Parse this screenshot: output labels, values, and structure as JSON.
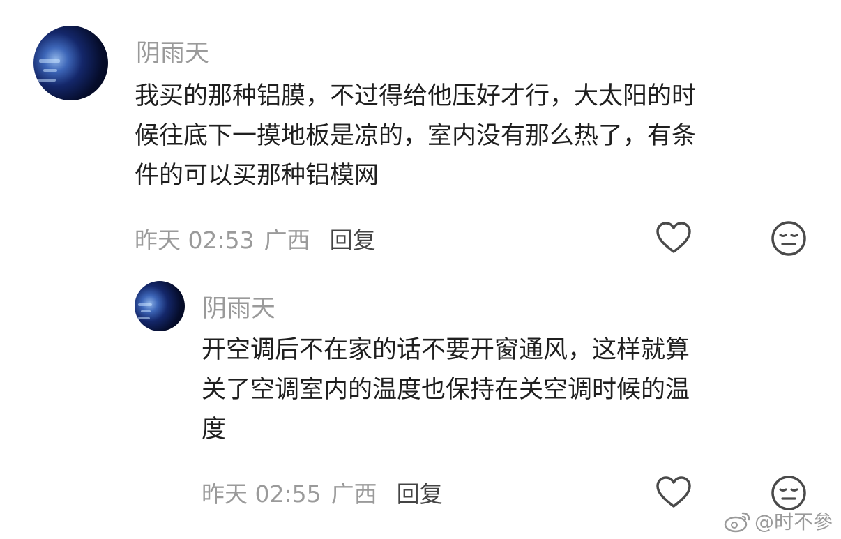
{
  "comments": [
    {
      "username": "阴雨天",
      "text_lines": [
        "我买的那种铝膜，不过得给他压好才行，大太阳的时",
        "候往底下一摸地板是凉的，室内没有那么热了，有条",
        "件的可以买那种铝模网"
      ],
      "time": "昨天 02:53",
      "location": "广西",
      "reply_label": "回复"
    },
    {
      "username": "阴雨天",
      "text_lines": [
        "开空调后不在家的话不要开窗通风，这样就算",
        "关了空调室内的温度也保持在关空调时候的温",
        "度"
      ],
      "time": "昨天 02:55",
      "location": "广西",
      "reply_label": "回复"
    }
  ],
  "watermark": {
    "handle": "@时不參"
  }
}
